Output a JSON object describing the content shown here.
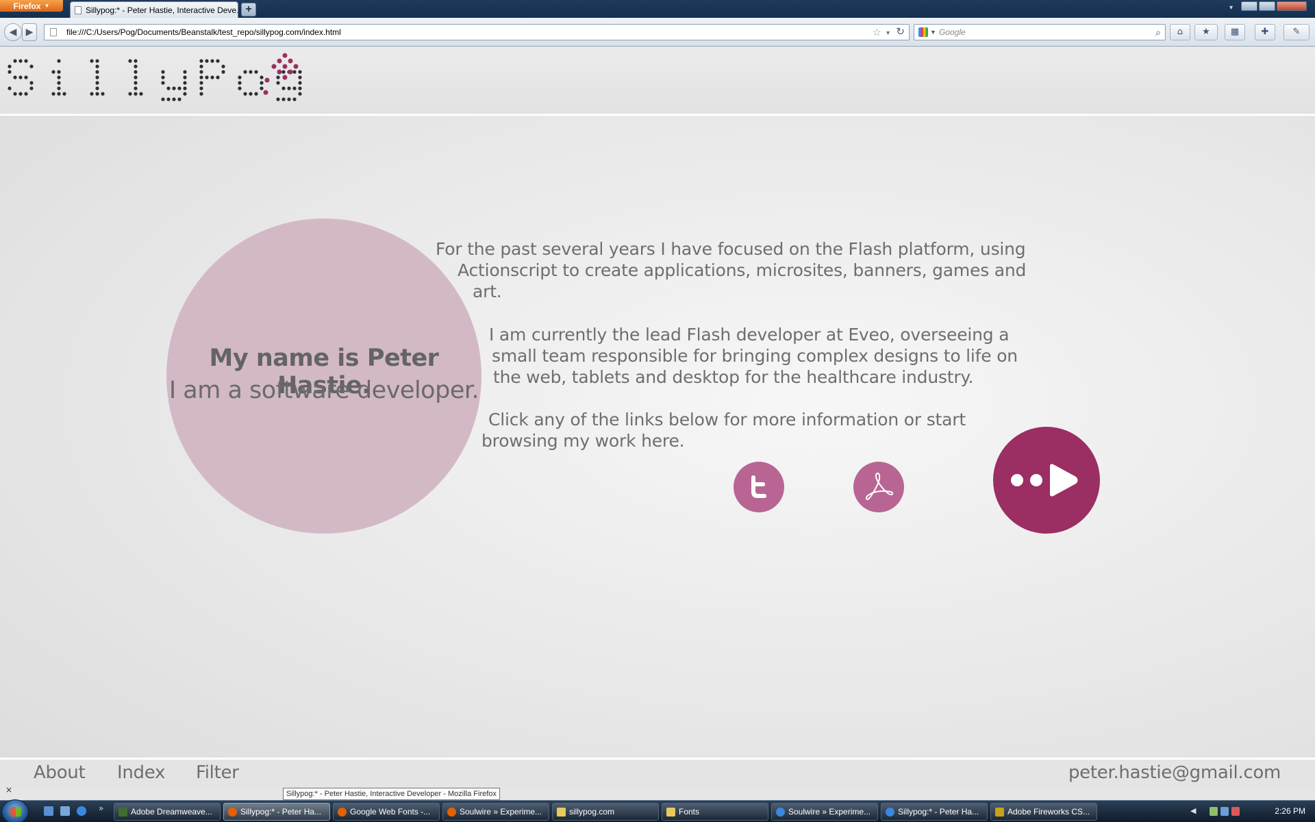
{
  "browser": {
    "menu_label": "Firefox",
    "tab_title": "Sillypog:* - Peter Hastie, Interactive Deve...",
    "new_tab_symbol": "+",
    "url": "file:///C:/Users/Pog/Documents/Beanstalk/test_repo/sillypog.com/index.html",
    "search_placeholder": "Google",
    "icons": [
      "back-icon",
      "forward-icon",
      "page-icon",
      "star-icon",
      "reload-icon",
      "google-icon",
      "search-icon",
      "home-icon",
      "bookmarks-icon",
      "grid-icon",
      "addon-icon",
      "extension-icon"
    ]
  },
  "site": {
    "logo_text": "SillyPog",
    "intro": {
      "name_line": "My name is Peter Hastie.",
      "role_line": "I am a software developer."
    },
    "bio": {
      "p1": [
        "For the past several years I have focused on the Flash platform, using",
        "Actionscript to create applications, microsites, banners, games and",
        "art."
      ],
      "p2": [
        "I am currently the lead Flash developer at Eveo, overseeing a",
        "small team responsible for bringing complex designs to life on",
        "the web, tablets and desktop for the healthcare industry."
      ],
      "p3": [
        "Click any of the links below for more information or start",
        "browsing my work here."
      ]
    },
    "links": [
      {
        "name": "twitter",
        "icon": "twitter-icon"
      },
      {
        "name": "resume-pdf",
        "icon": "acrobat-pdf-icon"
      },
      {
        "name": "browse-work",
        "icon": "play-icon"
      }
    ],
    "colors": {
      "intro_circle": "#d3b9c6",
      "social": "#b86593",
      "play": "#9b2e63",
      "logo_accent": "#9b2e63",
      "text": "#6e6e6e"
    },
    "footer": {
      "nav": [
        "About",
        "Index",
        "Filter"
      ],
      "email": "peter.hastie@gmail.com"
    }
  },
  "status": {
    "close_symbol": "×",
    "tooltip": "Sillypog:* - Peter Hastie, Interactive Developer - Mozilla Firefox"
  },
  "taskbar": {
    "items": [
      "Adobe Dreamweave...",
      "Sillypog:* - Peter Ha...",
      "Google Web Fonts -...",
      "Soulwire » Experime...",
      "sillypog.com",
      "Fonts",
      "Soulwire » Experime...",
      "Sillypog:* - Peter Ha...",
      "Adobe Fireworks CS..."
    ],
    "active_index": 1,
    "clock": "2:26 PM"
  }
}
